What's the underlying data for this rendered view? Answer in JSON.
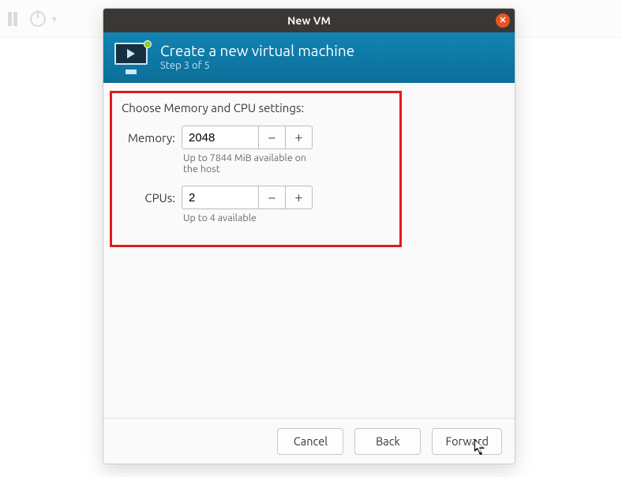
{
  "window": {
    "title": "New VM"
  },
  "banner": {
    "title": "Create a new virtual machine",
    "step": "Step 3 of 5"
  },
  "form": {
    "section_label": "Choose Memory and CPU settings:",
    "memory": {
      "label": "Memory:",
      "value": "2048",
      "hint": "Up to 7844 MiB available on the host"
    },
    "cpus": {
      "label": "CPUs:",
      "value": "2",
      "hint": "Up to 4 available"
    },
    "minus_glyph": "−",
    "plus_glyph": "+"
  },
  "buttons": {
    "cancel": "Cancel",
    "back": "Back",
    "forward": "Forward"
  }
}
